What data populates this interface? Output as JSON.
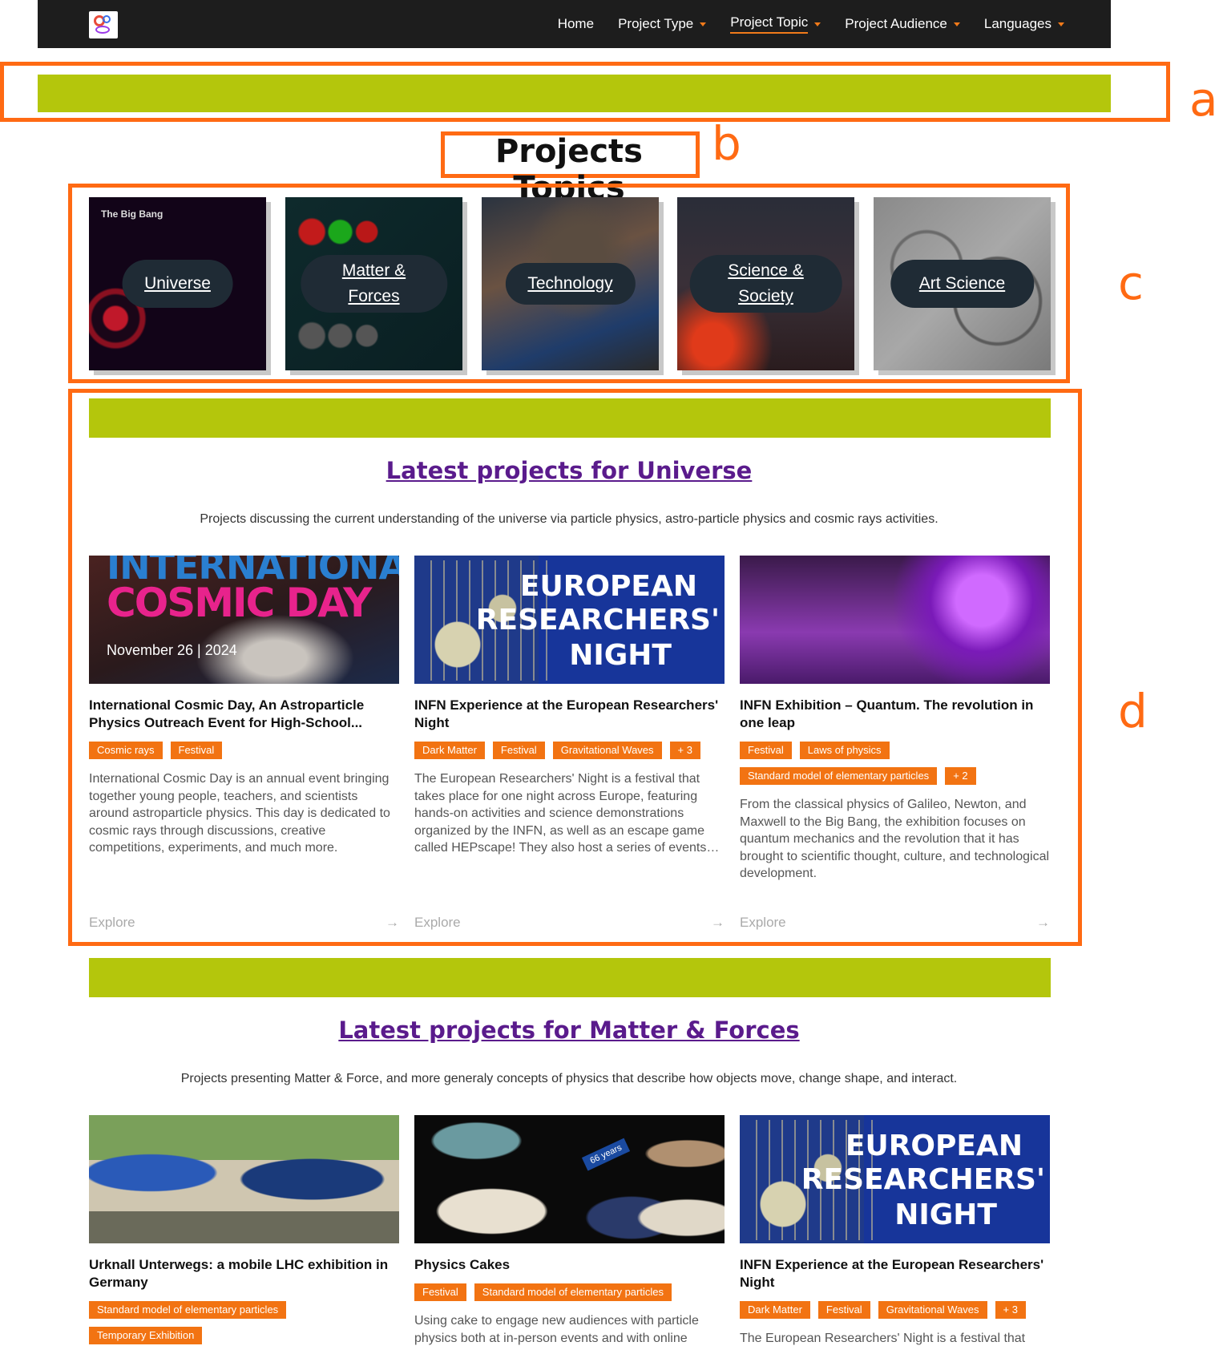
{
  "nav": {
    "items": [
      {
        "label": "Home",
        "dropdown": false,
        "active": false
      },
      {
        "label": "Project Type",
        "dropdown": true,
        "active": false
      },
      {
        "label": "Project Topic",
        "dropdown": true,
        "active": true
      },
      {
        "label": "Project Audience",
        "dropdown": true,
        "active": false
      },
      {
        "label": "Languages",
        "dropdown": true,
        "active": false
      }
    ]
  },
  "annotations": {
    "a": "a",
    "b": "b",
    "c": "c",
    "d": "d"
  },
  "page_title": "Projects Topics",
  "topics": [
    {
      "label_line1": "Universe",
      "label_line2": "",
      "caption": "The Big Bang"
    },
    {
      "label_line1": "Matter &",
      "label_line2": "Forces"
    },
    {
      "label_line1": "Technology",
      "label_line2": ""
    },
    {
      "label_line1": "Science &",
      "label_line2": "Society"
    },
    {
      "label_line1": "Art Science",
      "label_line2": ""
    }
  ],
  "sections": [
    {
      "title": "Latest projects for Universe",
      "description": "Projects discussing the current understanding of the universe via particle physics, astro-particle physics and cosmic rays activities.",
      "cards": [
        {
          "image_text": {
            "line1": "INTERNATIONAL",
            "line2": "COSMIC DAY",
            "line3": "November 26 | 2024"
          },
          "title": "International Cosmic Day, An Astroparticle Physics Outreach Event for High-School...",
          "tags": [
            "Cosmic rays",
            "Festival"
          ],
          "description": "International Cosmic Day is an annual event bringing together young people, teachers, and scientists around astroparticle physics. This day is dedicated to cosmic rays through discussions, creative competitions, experiments, and much more.",
          "explore": "Explore"
        },
        {
          "image_text": {
            "line1": "EUROPEAN",
            "line2": "RESEARCHERS'",
            "line3": "NIGHT"
          },
          "title": "INFN Experience at the European Researchers' Night",
          "tags": [
            "Dark Matter",
            "Festival",
            "Gravitational Waves",
            "+ 3"
          ],
          "description": "The European Researchers' Night is a festival that takes place for one night across Europe, featuring hands-on activities and science demonstrations organized by the INFN, as well as an escape game called HEPscape! They also host a series of events…",
          "explore": "Explore"
        },
        {
          "title": "INFN Exhibition – Quantum. The revolution in one leap",
          "tags": [
            "Festival",
            "Laws of physics",
            "Standard model of elementary particles",
            "+ 2"
          ],
          "description": "From the classical physics of Galileo, Newton, and Maxwell to the Big Bang, the exhibition focuses on quantum mechanics and the revolution that it has brought to scientific thought, culture, and technological development.",
          "explore": "Explore"
        }
      ]
    },
    {
      "title": "Latest projects for Matter & Forces",
      "description": "Projects presenting Matter & Force, and more generaly concepts of physics that describe how objects move, change shape, and interact.",
      "cards": [
        {
          "title": "Urknall Unterwegs: a mobile LHC exhibition in Germany",
          "tags": [
            "Standard model of elementary particles",
            "Temporary Exhibition"
          ],
          "description": ""
        },
        {
          "image_text": {
            "line1": "66 years"
          },
          "title": "Physics Cakes",
          "tags": [
            "Festival",
            "Standard model of elementary particles"
          ],
          "description": "Using cake to engage new audiences with particle physics both at in-person events and with online"
        },
        {
          "image_text": {
            "line1": "EUROPEAN",
            "line2": "RESEARCHERS'",
            "line3": "NIGHT"
          },
          "title": "INFN Experience at the European Researchers' Night",
          "tags": [
            "Dark Matter",
            "Festival",
            "Gravitational Waves",
            "+ 3"
          ],
          "description": "The European Researchers' Night is a festival that"
        }
      ]
    }
  ],
  "colors": {
    "accent_orange": "#f27312",
    "green_bar": "#b4c60c",
    "title_purple": "#5a1b8c",
    "annotation": "#ff6a13"
  }
}
